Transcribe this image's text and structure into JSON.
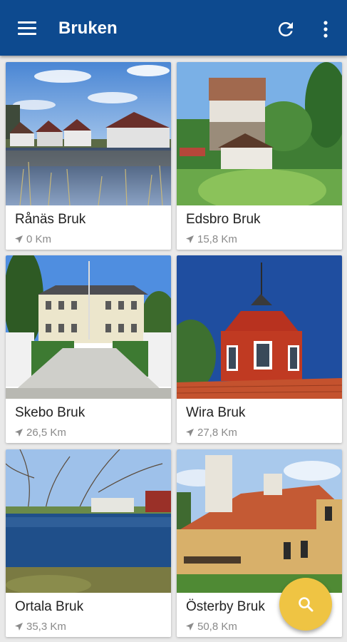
{
  "appbar": {
    "title": "Bruken",
    "color": "#0d4a8f",
    "icons": [
      "menu-icon",
      "refresh-icon",
      "more-vert-icon"
    ]
  },
  "cards": [
    {
      "name": "Rånäs Bruk",
      "distance": "0 Km"
    },
    {
      "name": "Edsbro Bruk",
      "distance": "15,8 Km"
    },
    {
      "name": "Skebo Bruk",
      "distance": "26,5 Km"
    },
    {
      "name": "Wira Bruk",
      "distance": "27,8 Km"
    },
    {
      "name": "Ortala Bruk",
      "distance": "35,3 Km"
    },
    {
      "name": "Österby Bruk",
      "distance": "50,8 Km"
    }
  ],
  "fab": {
    "icon": "search-icon",
    "color": "#efc443"
  }
}
